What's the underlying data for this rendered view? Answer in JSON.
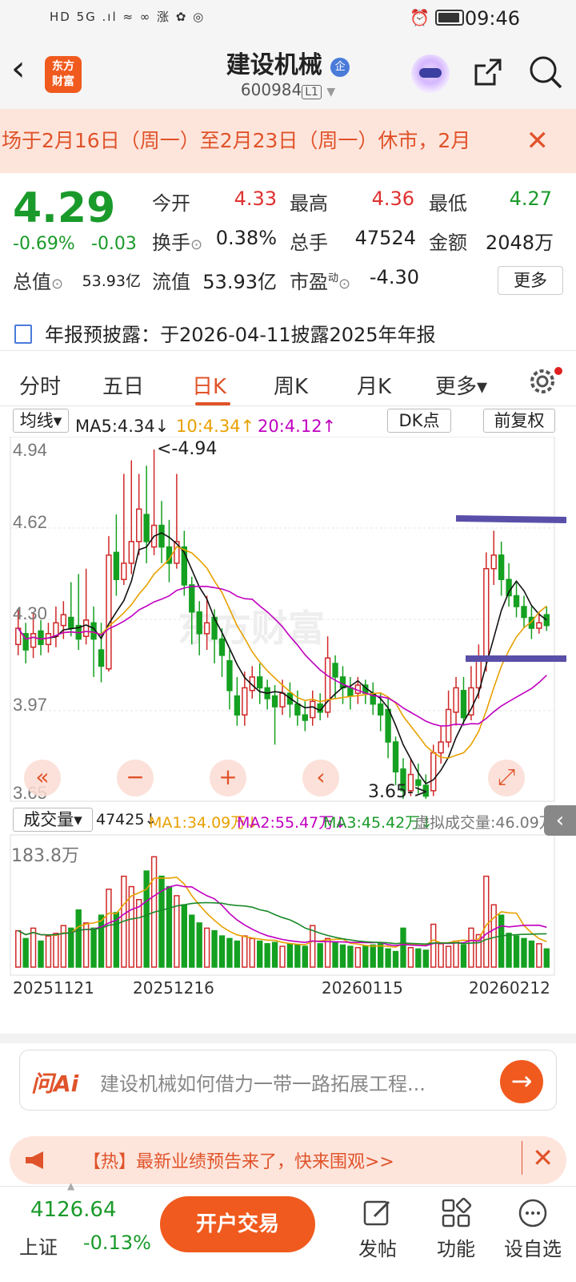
{
  "status_bar": {
    "time": "09:46",
    "left_icons": "HD 5G .ıl ≈ ∞ 涨  ✿ ◎"
  },
  "header": {
    "logo_text": "东方\n财富",
    "title": "建设机械",
    "qi_badge": "企",
    "code": "600984",
    "level": "L1"
  },
  "notice": {
    "text": "场于2月16日（周一）至2月23日（周一）休市，2月",
    "close": "✕"
  },
  "quote": {
    "price": "4.29",
    "change_pct": "-0.69%",
    "change": "-0.03",
    "open_label": "今开",
    "open": "4.33",
    "high_label": "最高",
    "high": "4.36",
    "low_label": "最低",
    "low": "4.27",
    "turnover_label": "换手",
    "turnover": "0.38%",
    "volume_label": "总手",
    "volume": "47524",
    "amount_label": "金额",
    "amount": "2048万",
    "mktcap_label": "总值",
    "mktcap": "53.93亿",
    "float_label": "流值",
    "float": "53.93亿",
    "pe_label": "市盈",
    "pe_sup": "动",
    "pe": "-4.30",
    "more_button": "更多"
  },
  "announcement": "年报预披露：于2026-04-11披露2025年年报",
  "tabs": [
    "分时",
    "五日",
    "日K",
    "周K",
    "月K",
    "更多▾"
  ],
  "active_tab": "日K",
  "ma_row": {
    "selector": "均线▾",
    "ma5": "MA5:4.34↓",
    "ma10": "10:4.34↑",
    "ma20": "20:4.12↑",
    "dk": "DK点",
    "adjust": "前复权"
  },
  "vol_row": {
    "selector": "成交量▾",
    "vol": "47425↓",
    "ma1": "MA1:34.09万↓",
    "ma2": "MA2:55.47万↓",
    "ma3": "MA3:45.42万↓",
    "virtual": "虚拟成交量:46.09万"
  },
  "chart_data": {
    "type": "candlestick",
    "y_ticks": [
      "4.94",
      "4.62",
      "4.30",
      "3.97",
      "3.65"
    ],
    "ylim": [
      3.65,
      4.94
    ],
    "max_label": "<-4.94",
    "min_label": "3.65->",
    "watermark": "东方财富",
    "volume_max_label": "183.8万",
    "x_labels": [
      "20251121",
      "20251216",
      "20260115",
      "20260212"
    ]
  },
  "chart_controls": [
    "«",
    "−",
    "+",
    "‹",
    "⤢"
  ],
  "ai": {
    "logo": "问Ai",
    "question": "建设机械如何借力一带一路拓展工程...",
    "go": "→"
  },
  "promo": {
    "text": "【热】最新业绩预告来了，快来围观>>",
    "close": "✕"
  },
  "bottom": {
    "index_value": "4126.64",
    "index_name": "上证",
    "index_change": "-0.13%",
    "trade_button": "开户交易",
    "nav": [
      "发帖",
      "功能",
      "设自选"
    ]
  },
  "colors": {
    "up": "#e03030",
    "down": "#1a9a2a",
    "accent": "#f05a1e"
  }
}
